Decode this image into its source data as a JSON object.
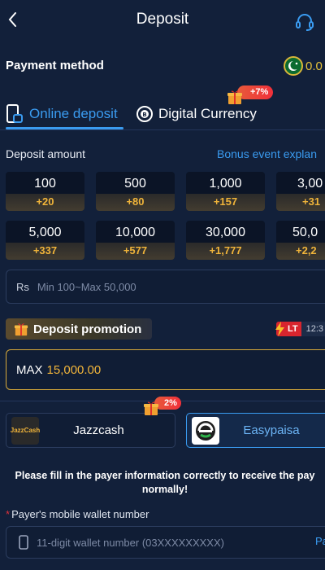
{
  "header": {
    "title": "Deposit",
    "back_icon": "chevron-left-icon",
    "support_icon": "headset-icon"
  },
  "payment_method": {
    "label": "Payment method",
    "balance": "0.0"
  },
  "tabs": [
    {
      "label": "Online deposit",
      "icon": "phone-card-icon",
      "active": true
    },
    {
      "label": "Digital Currency",
      "icon": "coin-icon",
      "badge": "+7%"
    }
  ],
  "deposit": {
    "label": "Deposit amount",
    "bonus_link": "Bonus event explan",
    "amounts": [
      {
        "value": "100",
        "bonus": "+20"
      },
      {
        "value": "500",
        "bonus": "+80"
      },
      {
        "value": "1,000",
        "bonus": "+157"
      },
      {
        "value": "3,00",
        "bonus": "+31"
      },
      {
        "value": "5,000",
        "bonus": "+337"
      },
      {
        "value": "10,000",
        "bonus": "+577"
      },
      {
        "value": "30,000",
        "bonus": "+1,777"
      },
      {
        "value": "50,0",
        "bonus": "+2,2"
      }
    ],
    "currency": "Rs",
    "placeholder": "Min 100~Max 50,000"
  },
  "promotion": {
    "label": "Deposit promotion",
    "lt_label": "LT",
    "timer": "12:3",
    "max_label": "MAX",
    "max_value": "15,000.00"
  },
  "methods": [
    {
      "name": "Jazzcash",
      "logo_text": "JazzCash",
      "badge": "2%",
      "selected": false
    },
    {
      "name": "Easypaisa",
      "selected": true
    }
  ],
  "notice": {
    "line1": "Please fill in the payer information correctly to receive the pay",
    "line2": "normally!"
  },
  "payer": {
    "required_mark": "*",
    "label": "Payer's mobile wallet number",
    "placeholder": "11-digit wallet number (03XXXXXXXXX)",
    "paste": "Pa"
  },
  "colors": {
    "accent": "#3a9bf0",
    "gold": "#f0b43a",
    "background": "#12203a"
  }
}
